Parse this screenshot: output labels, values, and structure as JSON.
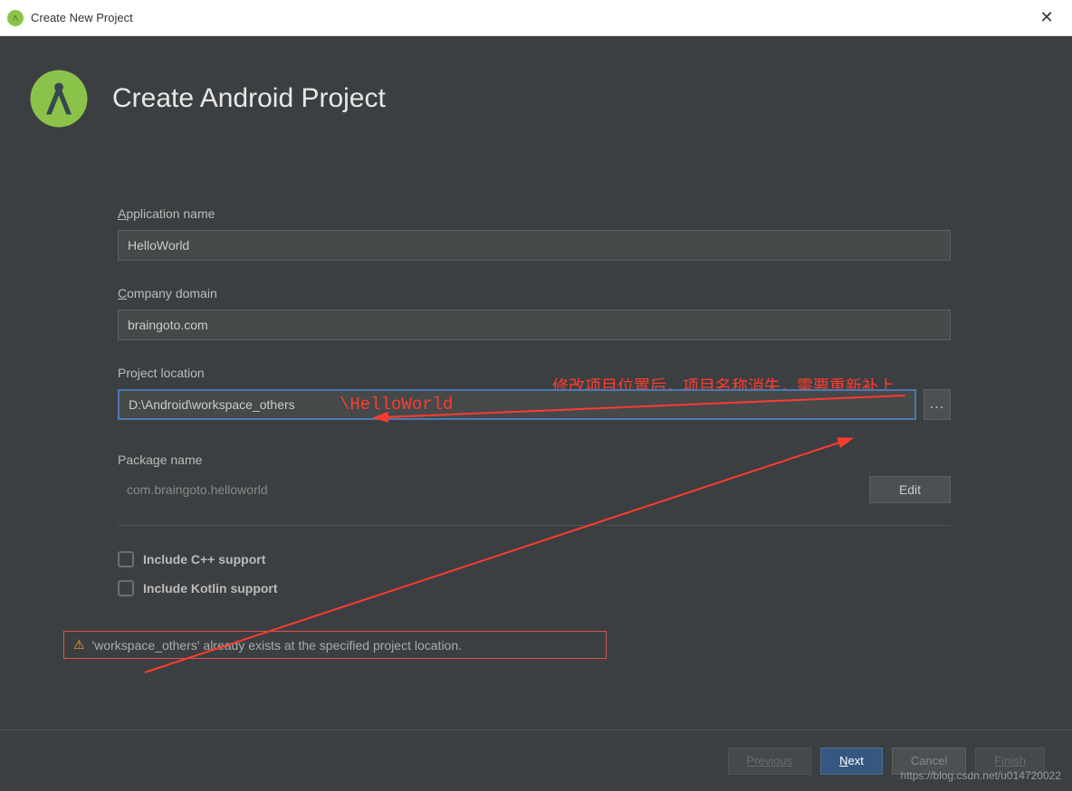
{
  "window": {
    "title": "Create New Project"
  },
  "header": {
    "title": "Create Android Project"
  },
  "fields": {
    "appname_label_prefix": "A",
    "appname_label_rest": "pplication name",
    "appname_value": "HelloWorld",
    "company_label_prefix": "C",
    "company_label_rest": "ompany domain",
    "company_value": "braingoto.com",
    "location_label": "Project location",
    "location_value": "D:\\Android\\workspace_others",
    "browse_label": "...",
    "package_label": "Package name",
    "package_value": "com.braingoto.helloworld",
    "edit_label": "Edit",
    "cpp_label": "Include C++ support",
    "kotlin_label": "Include Kotlin support"
  },
  "warning": {
    "text": "'workspace_others' already exists at the specified project location."
  },
  "buttons": {
    "previous": "Previous",
    "next_prefix": "N",
    "next_rest": "ext",
    "cancel": "Cancel",
    "finish": "Finish"
  },
  "annotations": {
    "top": "修改项目位置后，项目名称消失，需要重新补上",
    "inline": "\\HelloWorld"
  },
  "watermark": "https://blog.csdn.net/u014720022"
}
